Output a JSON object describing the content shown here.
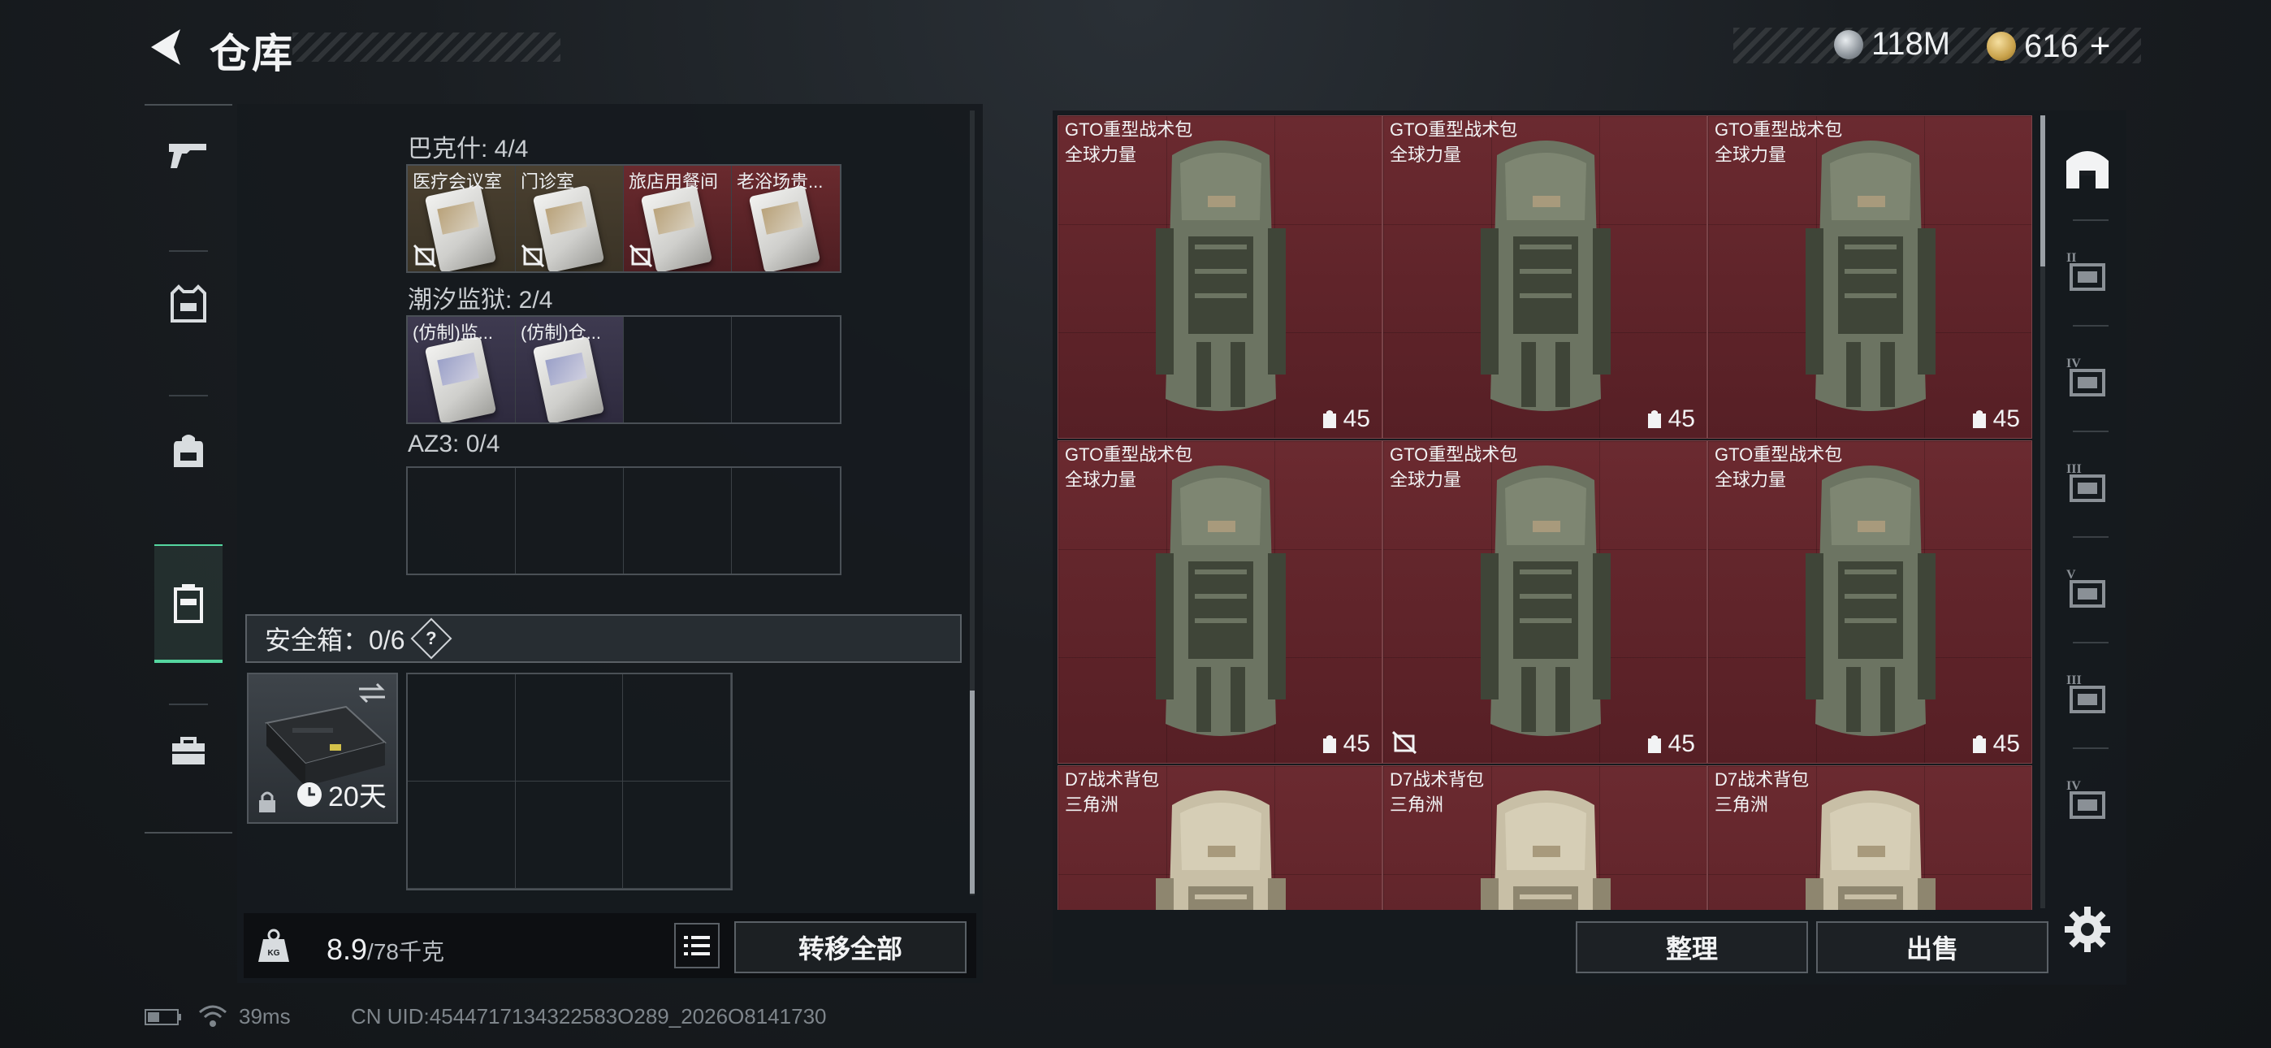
{
  "header": {
    "title": "仓库"
  },
  "currency": {
    "silver": "118M",
    "gold": "616",
    "add_label": "+"
  },
  "left_rail": [
    "gun-icon",
    "armor-icon",
    "backpack-icon",
    "container-icon",
    "toolbox-icon"
  ],
  "inventory": {
    "sections": [
      {
        "label": "巴克什: 4/4",
        "cells": [
          {
            "name": "医疗会议室",
            "style": "tan",
            "card": "gold",
            "locked": true
          },
          {
            "name": "门诊室",
            "style": "tan",
            "card": "gold",
            "locked": true
          },
          {
            "name": "旅店用餐间",
            "style": "red",
            "card": "gold",
            "locked": true
          },
          {
            "name": "老浴场贵...",
            "style": "red",
            "card": "gold",
            "locked": false
          }
        ]
      },
      {
        "label": "潮汐监狱: 2/4",
        "cells": [
          {
            "name": "(仿制)监...",
            "style": "purple",
            "card": "violet",
            "locked": false
          },
          {
            "name": "(仿制)仓...",
            "style": "purple",
            "card": "violet",
            "locked": false
          },
          null,
          null
        ]
      },
      {
        "label": "AZ3: 0/4",
        "cells": [
          null,
          null,
          null,
          null
        ]
      }
    ],
    "safe_box": {
      "label": "安全箱：0/6",
      "help": "?",
      "duration": "20天"
    },
    "weight": {
      "current": "8.9",
      "max": "/78千克"
    },
    "transfer_all": "转移全部"
  },
  "stash": {
    "items": [
      {
        "name": "GTO重型战术包",
        "sub": "全球力量",
        "capacity": "45",
        "type": "gto",
        "locked": false
      },
      {
        "name": "GTO重型战术包",
        "sub": "全球力量",
        "capacity": "45",
        "type": "gto",
        "locked": false
      },
      {
        "name": "GTO重型战术包",
        "sub": "全球力量",
        "capacity": "45",
        "type": "gto",
        "locked": false
      },
      {
        "name": "GTO重型战术包",
        "sub": "全球力量",
        "capacity": "45",
        "type": "gto",
        "locked": false
      },
      {
        "name": "GTO重型战术包",
        "sub": "全球力量",
        "capacity": "45",
        "type": "gto",
        "locked": true
      },
      {
        "name": "GTO重型战术包",
        "sub": "全球力量",
        "capacity": "45",
        "type": "gto",
        "locked": false
      },
      {
        "name": "D7战术背包",
        "sub": "三角洲",
        "capacity": "",
        "type": "d7",
        "locked": false
      },
      {
        "name": "D7战术背包",
        "sub": "三角洲",
        "capacity": "",
        "type": "d7",
        "locked": false
      },
      {
        "name": "D7战术背包",
        "sub": "三角洲",
        "capacity": "",
        "type": "d7",
        "locked": false
      }
    ],
    "sort_label": "整理",
    "sell_label": "出售"
  },
  "right_rail": [
    {
      "icon": "warehouse-icon",
      "tier": ""
    },
    {
      "icon": "tier-filter-icon",
      "tier": "II"
    },
    {
      "icon": "tier-filter-icon",
      "tier": "IV"
    },
    {
      "icon": "tier-filter-icon",
      "tier": "III"
    },
    {
      "icon": "tier-filter-icon",
      "tier": "V"
    },
    {
      "icon": "tier-filter-icon",
      "tier": "III"
    },
    {
      "icon": "tier-filter-icon",
      "tier": "IV"
    }
  ],
  "status": {
    "ping": "39ms",
    "uid": "CN UID:4544717134322583O289_2026O8141730"
  },
  "colors": {
    "accent": "#55d6a0",
    "stash_bg": "#6b2a30"
  }
}
